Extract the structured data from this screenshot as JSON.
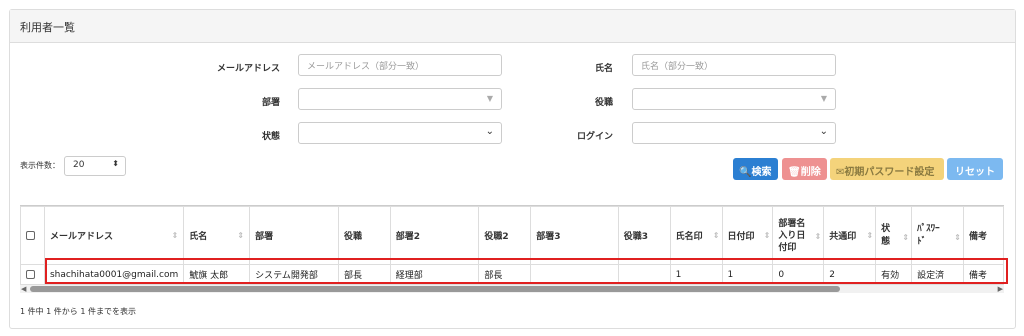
{
  "panel": {
    "title": "利用者一覧"
  },
  "form": {
    "email_label": "メールアドレス",
    "email_placeholder": "メールアドレス（部分一致）",
    "name_label": "氏名",
    "name_placeholder": "氏名（部分一致）",
    "department_label": "部署",
    "position_label": "役職",
    "status_label": "状態",
    "login_label": "ログイン"
  },
  "page_size": {
    "label": "表示件数：",
    "value": "20"
  },
  "buttons": {
    "search": "検索",
    "delete": "削除",
    "initial_password": "初期パスワード設定",
    "reset": "リセット"
  },
  "table": {
    "headers": [
      "メールアドレス",
      "氏名",
      "部署",
      "役職",
      "部署2",
      "役職2",
      "部署3",
      "役職3",
      "氏名印",
      "日付印",
      "部署名入り日付印",
      "共通印",
      "状態",
      "ﾊﾟｽﾜｰﾄﾞ",
      "備考"
    ],
    "header_lines": {
      "dept_date_stamp": [
        "部署名",
        "入り日",
        "付印"
      ],
      "status": [
        "状",
        "態"
      ],
      "password": [
        "ﾊﾟｽﾜｰ",
        "ﾄﾞ"
      ]
    },
    "rows": [
      [
        "shachihata0001@gmail.com",
        "鯱旗 太郎",
        "システム開発部",
        "部長",
        "経理部",
        "部長",
        "",
        "",
        "1",
        "1",
        "0",
        "2",
        "有効",
        "設定済",
        "備考"
      ]
    ]
  },
  "footer": {
    "summary": "1 件中 1 件から 1 件までを表示"
  },
  "colors": {
    "search": "#2b7fd2",
    "delete": "#ee9191",
    "password": "#f4d37b",
    "reset": "#7cb9f0",
    "highlight": "#e02020"
  }
}
